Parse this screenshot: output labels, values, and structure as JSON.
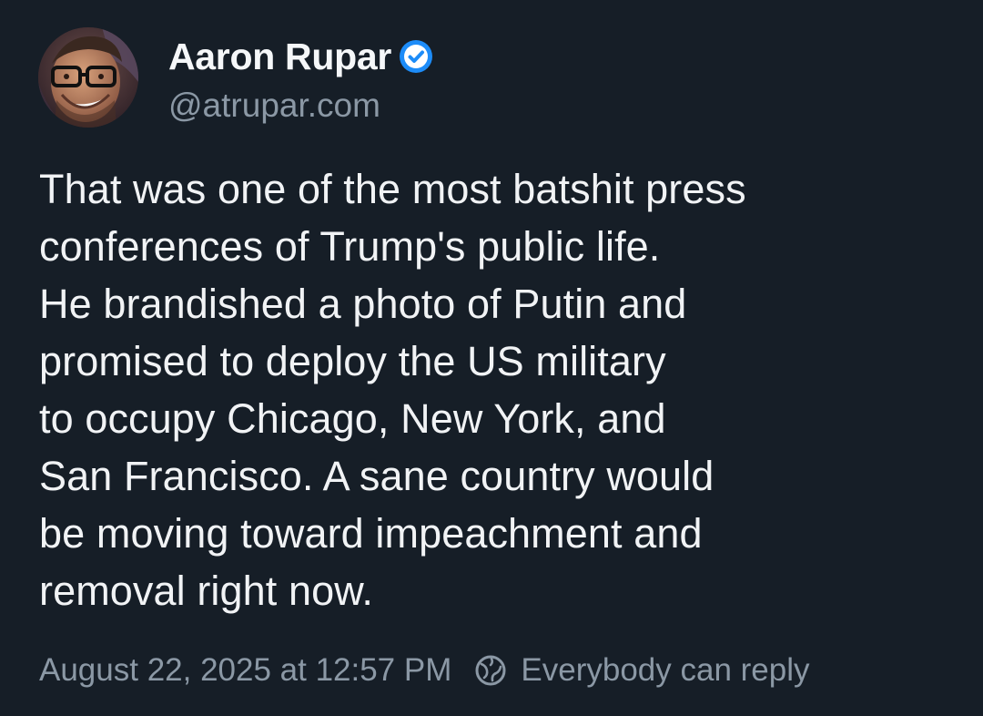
{
  "author": {
    "display_name": "Aaron Rupar",
    "handle": "@atrupar.com",
    "verified": true,
    "avatar_icon": "avatar-photo"
  },
  "post": {
    "text_lines": [
      "That was one of the most batshit press",
      "conferences of Trump's public life.",
      "He brandished a photo of Putin and",
      "promised to deploy the US military",
      "to occupy Chicago, New York, and",
      "San Francisco. A sane country would",
      "be moving toward impeachment and",
      "removal right now."
    ]
  },
  "meta": {
    "timestamp": "August 22, 2025 at 12:57 PM",
    "reply_setting": "Everybody can reply",
    "reply_icon": "globe-icon"
  },
  "colors": {
    "background": "#161e27",
    "text": "#f1f3f5",
    "muted": "#8b98a5",
    "verified": "#1d8cf8"
  }
}
